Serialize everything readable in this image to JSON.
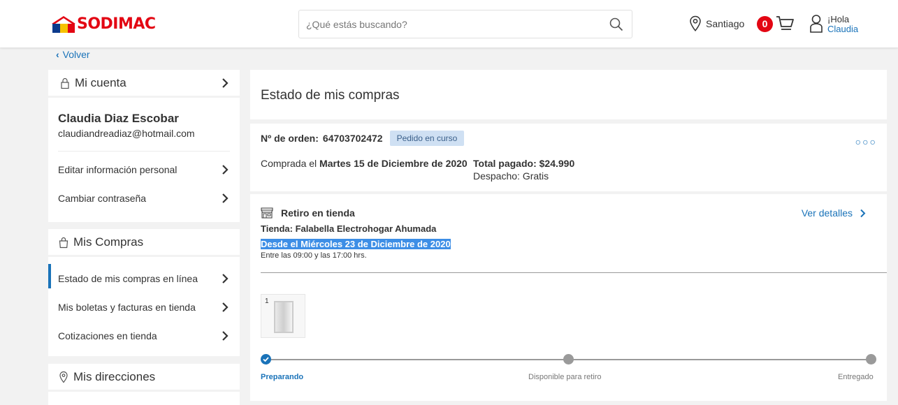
{
  "header": {
    "brand": "SODIMAC",
    "search": {
      "placeholder": "¿Qué estás buscando?",
      "value": ""
    },
    "location": "Santiago",
    "cart_count": "0",
    "greeting": "¡Hola",
    "user_name": "Claudia"
  },
  "back_label": "Volver",
  "sidebar": {
    "account": {
      "title": "Mi cuenta",
      "user_full_name": "Claudia Diaz Escobar",
      "email": "claudiandreadiaz@hotmail.com",
      "items": [
        {
          "label": "Editar información personal"
        },
        {
          "label": "Cambiar contraseña"
        }
      ]
    },
    "purchases": {
      "title": "Mis Compras",
      "items": [
        {
          "label": "Estado de mis compras en línea",
          "active": true
        },
        {
          "label": "Mis boletas y facturas en tienda"
        },
        {
          "label": "Cotizaciones en tienda"
        }
      ]
    },
    "addresses": {
      "title": "Mis direcciones"
    }
  },
  "main": {
    "title": "Estado de mis compras",
    "order": {
      "number_label": "Nº de orden:",
      "number": "64703702472",
      "status": "Pedido en curso",
      "purchased_prefix": "Comprada el",
      "purchased_date": "Martes 15 de Diciembre de 2020",
      "total_label": "Total pagado: $24.990",
      "shipping_label": "Despacho: Gratis",
      "menu_icon": "more-dots-icon"
    },
    "pickup": {
      "title": "Retiro en tienda",
      "details_link": "Ver detalles",
      "store": "Tienda: Falabella Electrohogar Ahumada",
      "from_date": "Desde el  Miércoles 23 de Diciembre de 2020",
      "hours": "Entre las 09:00 y las 17:00 hrs.",
      "product_qty": "1"
    },
    "steps": [
      {
        "label": "Preparando",
        "state": "done"
      },
      {
        "label": "Disponible para retiro",
        "state": "pending"
      },
      {
        "label": "Entregado",
        "state": "pending"
      }
    ]
  },
  "colors": {
    "brand_red": "#e30613",
    "link_blue": "#1a73b9",
    "status_pill": "#cfe0f3",
    "highlight": "#3d8ee6"
  }
}
